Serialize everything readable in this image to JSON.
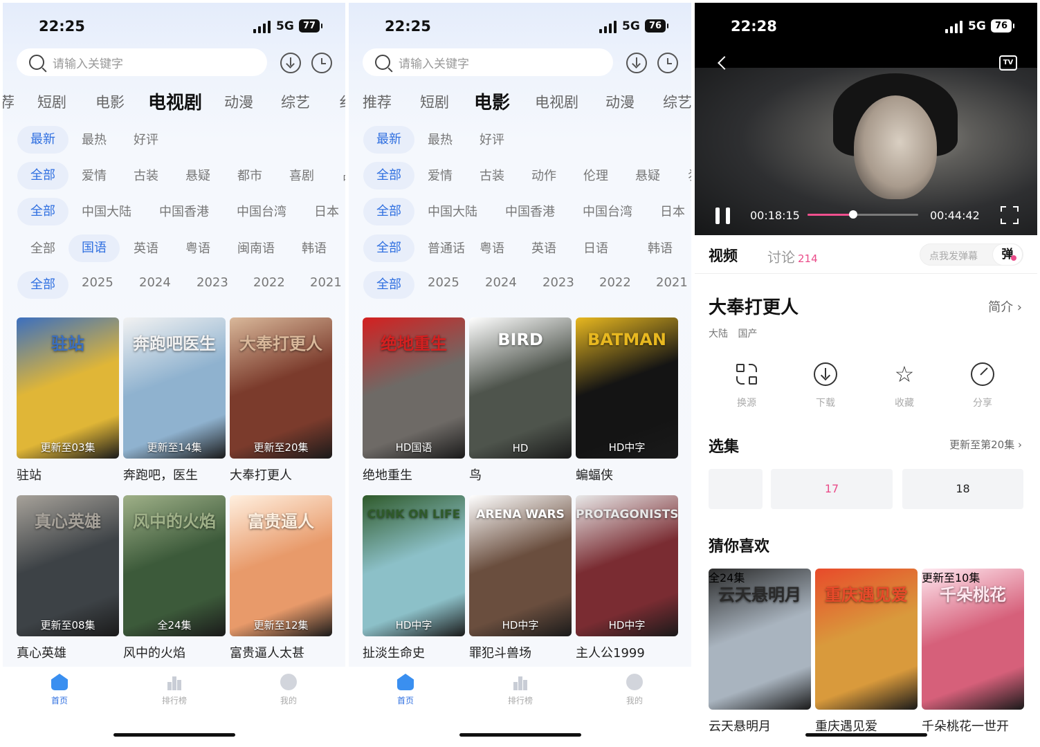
{
  "screens": [
    {
      "status": {
        "time": "22:25",
        "network": "5G",
        "battery": "77"
      },
      "search": {
        "placeholder": "请输入关键字"
      },
      "tabs": [
        "荐",
        "短剧",
        "电影",
        "电视剧",
        "动漫",
        "综艺",
        "纟"
      ],
      "active_tab": 3,
      "filters": [
        [
          "最新",
          "最热",
          "好评"
        ],
        [
          "全部",
          "爱情",
          "古装",
          "悬疑",
          "都市",
          "喜剧",
          "占"
        ],
        [
          "全部",
          "中国大陆",
          "中国香港",
          "中国台湾",
          "日本"
        ],
        [
          "全部",
          "国语",
          "英语",
          "粤语",
          "闽南语",
          "韩语"
        ],
        [
          "全部",
          "2025",
          "2024",
          "2023",
          "2022",
          "2021"
        ]
      ],
      "selected_filters": [
        0,
        0,
        0,
        1,
        0
      ],
      "cards": [
        {
          "title": "驻站",
          "badge": "更新至03集",
          "art": "驻站",
          "color": "#e0b637",
          "accent": "#3b6fbf"
        },
        {
          "title": "奔跑吧，医生",
          "badge": "更新至14集",
          "art": "奔跑吧医生",
          "color": "#8fb2cf",
          "accent": "#f2f2f2"
        },
        {
          "title": "大奉打更人",
          "badge": "更新至20集",
          "art": "大奉打更人",
          "color": "#7b3b2c",
          "accent": "#d9b89a"
        },
        {
          "title": "真心英雄",
          "badge": "更新至08集",
          "art": "真心英雄",
          "color": "#3d4246",
          "accent": "#a7a29a"
        },
        {
          "title": "风中的火焰",
          "badge": "全24集",
          "art": "风中的火焰",
          "color": "#3c5a3a",
          "accent": "#9fb088"
        },
        {
          "title": "富贵逼人太甚",
          "badge": "更新至12集",
          "art": "富贵逼人",
          "color": "#e89a6a",
          "accent": "#fff0e0"
        }
      ],
      "nav": [
        "首页",
        "排行榜",
        "我的"
      ]
    },
    {
      "status": {
        "time": "22:25",
        "network": "5G",
        "battery": "76"
      },
      "search": {
        "placeholder": "请输入关键字"
      },
      "tabs": [
        "推荐",
        "短剧",
        "电影",
        "电视剧",
        "动漫",
        "综艺"
      ],
      "active_tab": 2,
      "filters": [
        [
          "最新",
          "最热",
          "好评"
        ],
        [
          "全部",
          "爱情",
          "古装",
          "动作",
          "伦理",
          "悬疑",
          "犭"
        ],
        [
          "全部",
          "中国大陆",
          "中国香港",
          "中国台湾",
          "日本"
        ],
        [
          "全部",
          "普通话",
          "粤语",
          "英语",
          "日语",
          "韩语"
        ],
        [
          "全部",
          "2025",
          "2024",
          "2023",
          "2022",
          "2021"
        ]
      ],
      "selected_filters": [
        0,
        0,
        0,
        0,
        0
      ],
      "cards": [
        {
          "title": "绝地重生",
          "badge": "HD国语",
          "art": "绝地重生",
          "color": "#6e6a66",
          "accent": "#d42020"
        },
        {
          "title": "鸟",
          "badge": "HD",
          "art": "BIRD",
          "color": "#4e544c",
          "accent": "#ffffff"
        },
        {
          "title": "蝙蝠侠",
          "badge": "HD中字",
          "art": "BATMAN",
          "color": "#141414",
          "accent": "#e8b820"
        },
        {
          "title": "扯淡生命史",
          "badge": "HD中字",
          "art": "CUNK ON LIFE",
          "color": "#8cc0c8",
          "accent": "#2f5a2a"
        },
        {
          "title": "罪犯斗兽场",
          "badge": "HD中字",
          "art": "ARENA WARS",
          "color": "#6a4e3e",
          "accent": "#ffffff"
        },
        {
          "title": "主人公1999",
          "badge": "HD中字",
          "art": "PROTAGONISTS",
          "color": "#7a2c32",
          "accent": "#e8e8e8"
        }
      ],
      "nav": [
        "首页",
        "排行榜",
        "我的"
      ]
    }
  ],
  "player": {
    "status": {
      "time": "22:28",
      "network": "5G",
      "battery": "76"
    },
    "tv_label": "TV",
    "current_time": "00:18:15",
    "total_time": "00:44:42",
    "progress": 0.41,
    "tab_video": "视频",
    "tab_discuss": "讨论",
    "discuss_count": "214",
    "danmu_placeholder": "点我发弹幕",
    "danmu_button": "弹",
    "title": "大奉打更人",
    "intro": "简介 ›",
    "tags": [
      "大陆",
      "国产"
    ],
    "actions": [
      "换源",
      "下载",
      "收藏",
      "分享"
    ],
    "episodes_label": "选集",
    "update_text": "更新至第20集 ›",
    "episodes": [
      "",
      "17",
      "18"
    ],
    "recommend_label": "猜你喜欢",
    "recommend": [
      {
        "title": "云天悬明月",
        "badge": "全24集",
        "art": "云天悬明月",
        "color": "#a9b4bf",
        "accent": "#2a2a2a"
      },
      {
        "title": "重庆遇见爱",
        "badge": "",
        "art": "重庆遇见爱",
        "color": "#d99a3c",
        "accent": "#e84a2a"
      },
      {
        "title": "千朵桃花一世开",
        "badge": "更新至10集",
        "art": "千朵桃花",
        "color": "#d6607a",
        "accent": "#ffe8f0"
      }
    ]
  }
}
